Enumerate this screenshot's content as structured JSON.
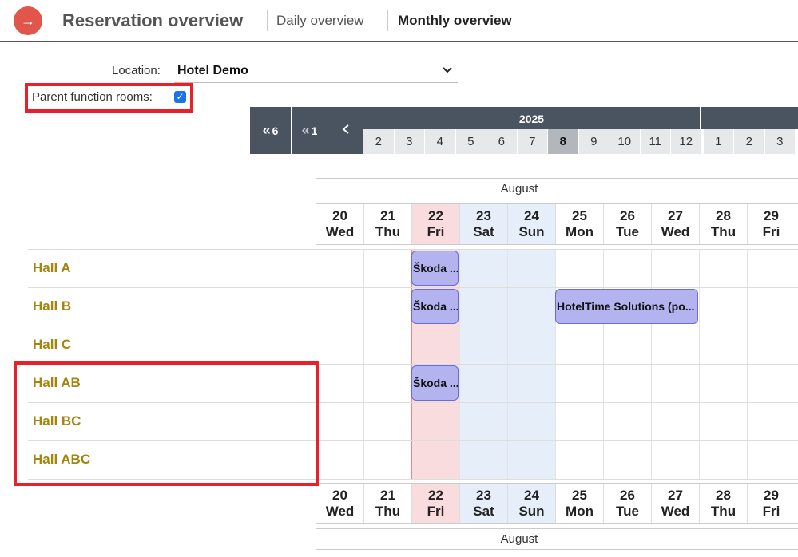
{
  "header": {
    "title": "Reservation overview",
    "tabs": [
      {
        "label": "Daily overview"
      },
      {
        "label": "Monthly overview",
        "active": true
      }
    ]
  },
  "filters": {
    "location_label": "Location:",
    "location_value": "Hotel Demo",
    "parent_label": "Parent function rooms:",
    "parent_checked": true
  },
  "navigator": {
    "buttons": [
      "6",
      "1"
    ],
    "year": "2025",
    "months": [
      "2",
      "3",
      "4",
      "5",
      "6",
      "7",
      "8",
      "9",
      "10",
      "11",
      "12",
      "1",
      "2",
      "3"
    ],
    "selected_month": "8"
  },
  "calendar": {
    "month_label": "August",
    "days": [
      {
        "num": "20",
        "dow": "Wed"
      },
      {
        "num": "21",
        "dow": "Thu"
      },
      {
        "num": "22",
        "dow": "Fri"
      },
      {
        "num": "23",
        "dow": "Sat"
      },
      {
        "num": "24",
        "dow": "Sun"
      },
      {
        "num": "25",
        "dow": "Mon"
      },
      {
        "num": "26",
        "dow": "Tue"
      },
      {
        "num": "27",
        "dow": "Wed"
      },
      {
        "num": "28",
        "dow": "Thu"
      },
      {
        "num": "29",
        "dow": "Fri"
      }
    ]
  },
  "halls": [
    "Hall A",
    "Hall B",
    "Hall C",
    "Hall AB",
    "Hall BC",
    "Hall ABC"
  ],
  "events": [
    {
      "label": "Škoda ..."
    },
    {
      "label": "Škoda ..."
    },
    {
      "label": "HotelTime Solutions (po..."
    },
    {
      "label": "Škoda ..."
    }
  ],
  "colors": {
    "accent": "#e0564a",
    "nav": "#4a5461",
    "hall_text": "#a4850f",
    "event_fill": "#b3b3ef",
    "today": "#f9dcde",
    "weekend": "#e5eef9",
    "highlight": "#e8202a"
  }
}
